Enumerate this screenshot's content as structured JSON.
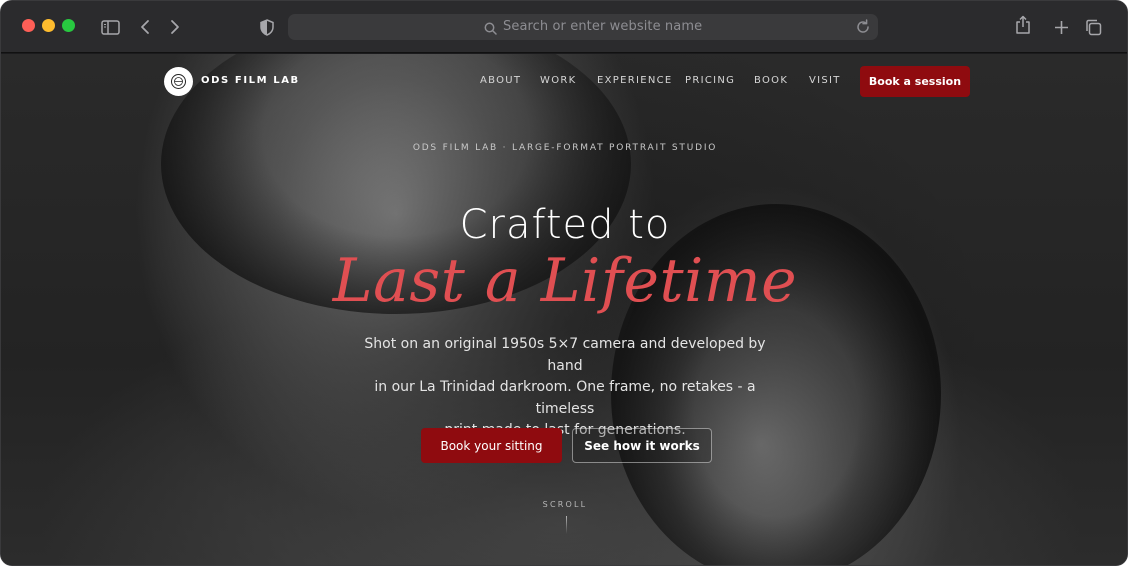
{
  "browser": {
    "address_placeholder": "Search or enter website name",
    "icons": {
      "sidebar": "sidebar-icon",
      "back": "chevron-left-icon",
      "forward": "chevron-right-icon",
      "privacy": "shield-icon",
      "search": "search-icon",
      "reload": "reload-icon",
      "share": "share-icon",
      "new_tab": "plus-icon",
      "tabs": "tabs-overview-icon"
    },
    "traffic_colors": {
      "close": "#fe5f57",
      "minimize": "#febc2e",
      "maximize": "#28c840"
    }
  },
  "site": {
    "logo_text": "ODS FILM LAB",
    "nav": [
      {
        "label": "ABOUT"
      },
      {
        "label": "WORK"
      },
      {
        "label": "EXPERIENCE"
      },
      {
        "label": "PRICING"
      },
      {
        "label": "BOOK"
      },
      {
        "label": "VISIT"
      }
    ],
    "cta_label": "Book a session"
  },
  "hero": {
    "eyebrow": "ODS FILM LAB · LARGE-FORMAT PORTRAIT STUDIO",
    "title_line1": "Crafted to",
    "title_line2": "Last a Lifetime",
    "body_line1": "Shot on an original 1950s 5×7 camera and developed by hand",
    "body_line2": "in our La Trinidad darkroom. One frame, no retakes - a timeless",
    "body_line3": "print made to last for generations.",
    "primary_button": "Book your sitting",
    "secondary_button": "See how it works",
    "scroll_label": "SCROLL"
  },
  "colors": {
    "accent": "#e04f52",
    "button_red": "#8f0b0f",
    "chrome_bg": "#2b2b2d"
  }
}
